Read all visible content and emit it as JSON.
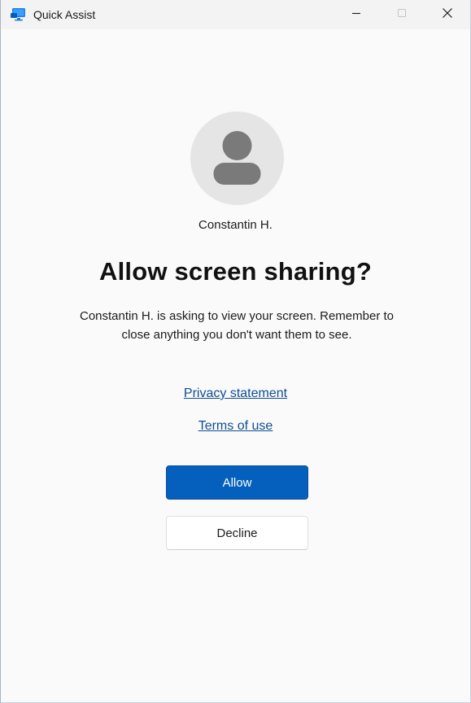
{
  "window": {
    "title": "Quick Assist",
    "app_icon": "quick-assist-monitor-icon",
    "controls": {
      "minimize": "minimize-icon",
      "maximize": "maximize-icon",
      "close": "close-icon"
    }
  },
  "prompt": {
    "avatar_icon": "person-icon",
    "user_name": "Constantin H.",
    "heading": "Allow screen sharing?",
    "message": "Constantin H. is asking to view your screen. Remember to close anything you don't want them to see.",
    "links": {
      "privacy": "Privacy statement",
      "terms": "Terms of use"
    },
    "buttons": {
      "allow": "Allow",
      "decline": "Decline"
    }
  },
  "colors": {
    "accent": "#0560bd",
    "link": "#0f4d96",
    "avatar_bg": "#e5e5e5",
    "avatar_fg": "#7a7a7a"
  }
}
